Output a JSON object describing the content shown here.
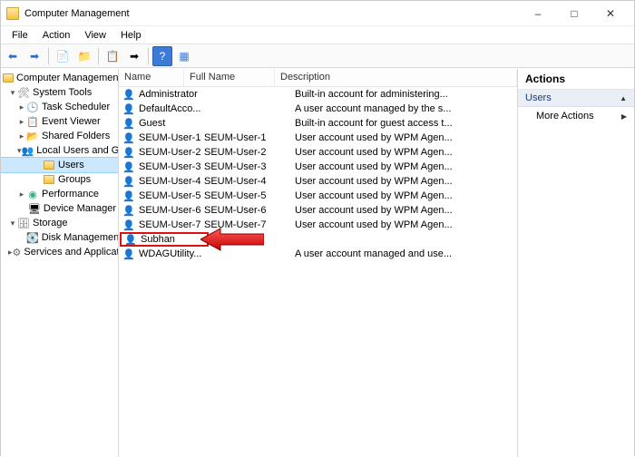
{
  "window": {
    "title": "Computer Management"
  },
  "menu": {
    "file": "File",
    "action": "Action",
    "view": "View",
    "help": "Help"
  },
  "toolbar": {
    "back": "back-icon",
    "forward": "forward-icon",
    "up": "up-icon",
    "folder": "folder-icon",
    "refresh": "refresh-icon",
    "export": "export-icon",
    "help": "help-icon",
    "tile": "tile-icon"
  },
  "tree": {
    "root": "Computer Management (Local",
    "systools": "System Tools",
    "task": "Task Scheduler",
    "event": "Event Viewer",
    "shared": "Shared Folders",
    "lug": "Local Users and Groups",
    "users": "Users",
    "groups": "Groups",
    "perf": "Performance",
    "devmgr": "Device Manager",
    "storage": "Storage",
    "diskmgmt": "Disk Management",
    "svcapp": "Services and Applications"
  },
  "columns": {
    "name": "Name",
    "full": "Full Name",
    "desc": "Description"
  },
  "users": [
    {
      "name": "Administrator",
      "full": "",
      "desc": "Built-in account for administering..."
    },
    {
      "name": "DefaultAcco...",
      "full": "",
      "desc": "A user account managed by the s..."
    },
    {
      "name": "Guest",
      "full": "",
      "desc": "Built-in account for guest access t..."
    },
    {
      "name": "SEUM-User-1",
      "full": "SEUM-User-1",
      "desc": "User account used by WPM Agen..."
    },
    {
      "name": "SEUM-User-2",
      "full": "SEUM-User-2",
      "desc": "User account used by WPM Agen..."
    },
    {
      "name": "SEUM-User-3",
      "full": "SEUM-User-3",
      "desc": "User account used by WPM Agen..."
    },
    {
      "name": "SEUM-User-4",
      "full": "SEUM-User-4",
      "desc": "User account used by WPM Agen..."
    },
    {
      "name": "SEUM-User-5",
      "full": "SEUM-User-5",
      "desc": "User account used by WPM Agen..."
    },
    {
      "name": "SEUM-User-6",
      "full": "SEUM-User-6",
      "desc": "User account used by WPM Agen..."
    },
    {
      "name": "SEUM-User-7",
      "full": "SEUM-User-7",
      "desc": "User account used by WPM Agen..."
    },
    {
      "name": "Subhan",
      "full": "",
      "desc": "",
      "highlight": true
    },
    {
      "name": "WDAGUtility...",
      "full": "",
      "desc": "A user account managed and use..."
    }
  ],
  "actions": {
    "title": "Actions",
    "section": "Users",
    "more": "More Actions"
  }
}
